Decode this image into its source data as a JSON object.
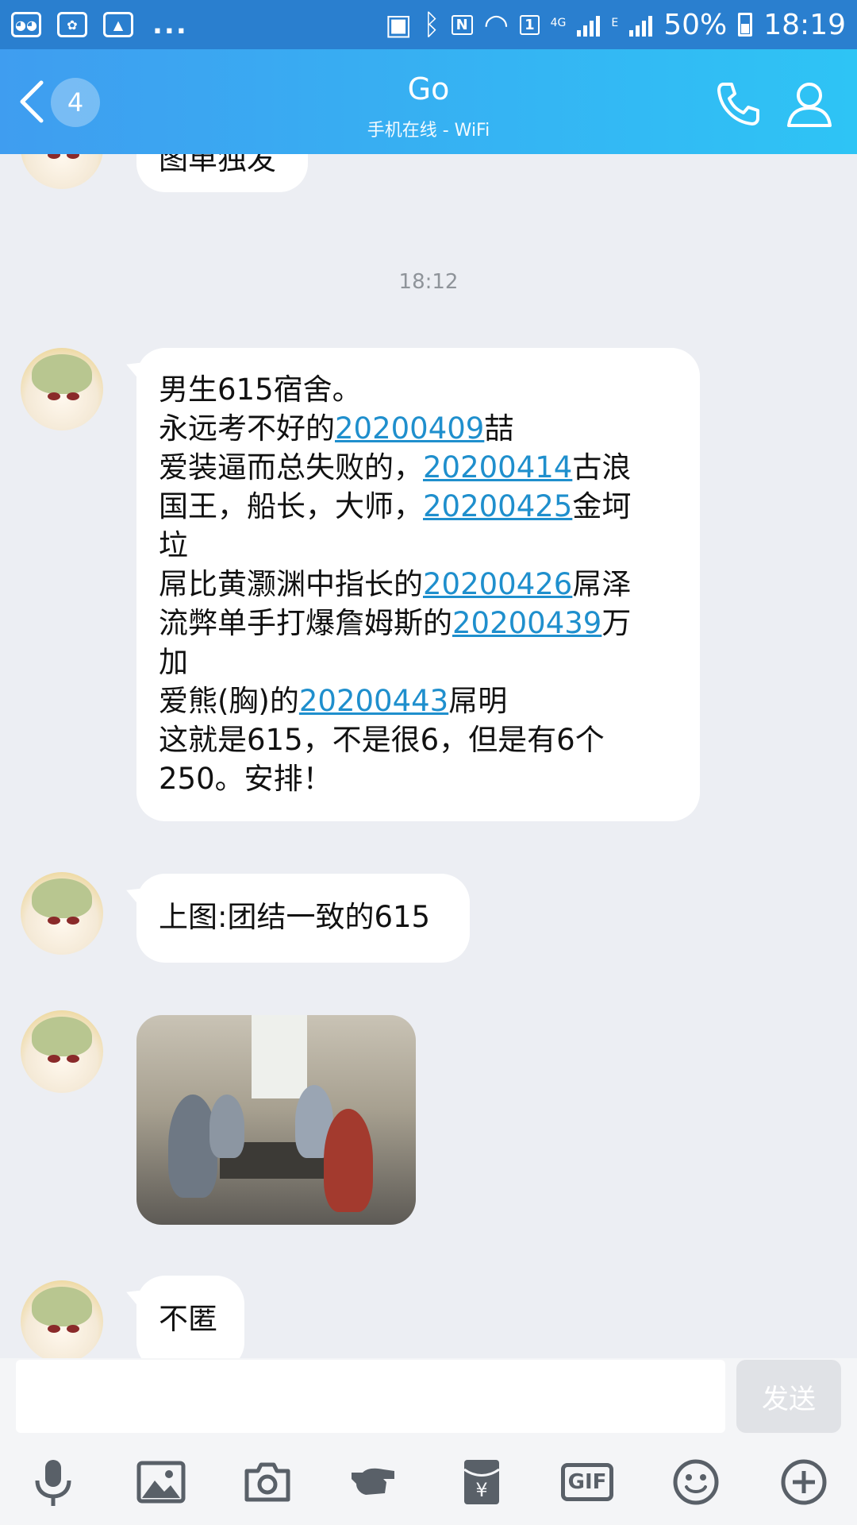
{
  "status_bar": {
    "left_icons": [
      "wechat-icon",
      "baidu-icon",
      "image-icon"
    ],
    "more": "...",
    "network": "4G",
    "network_e": "E",
    "sim": "1",
    "battery": "50%",
    "time": "18:19"
  },
  "header": {
    "back_badge": "4",
    "title": "Go",
    "subtitle": "手机在线 - WiFi",
    "icons": [
      "phone-icon",
      "person-icon"
    ]
  },
  "chat": {
    "partial_message": "图单独发",
    "timestamp": "18:12",
    "message1": {
      "lines": [
        [
          {
            "t": "男生615宿舍。"
          }
        ],
        [
          {
            "t": "永远考不好的"
          },
          {
            "t": "20200409",
            "link": true
          },
          {
            "t": "喆"
          }
        ],
        [
          {
            "t": "爱装逼而总失败的，"
          },
          {
            "t": "20200414",
            "link": true
          },
          {
            "t": "古浪"
          }
        ],
        [
          {
            "t": "国王，船长，大师，"
          },
          {
            "t": "20200425",
            "link": true
          },
          {
            "t": "金坷"
          }
        ],
        [
          {
            "t": "垃"
          }
        ],
        [
          {
            "t": "屌比黄灏渊中指长的"
          },
          {
            "t": "20200426",
            "link": true
          },
          {
            "t": "屌泽"
          }
        ],
        [
          {
            "t": "流弊单手打爆詹姆斯的"
          },
          {
            "t": "20200439",
            "link": true
          },
          {
            "t": "万"
          }
        ],
        [
          {
            "t": "加"
          }
        ],
        [
          {
            "t": "爱熊(胸)的"
          },
          {
            "t": "20200443",
            "link": true
          },
          {
            "t": "屌明"
          }
        ],
        [
          {
            "t": "这就是615，不是很6，但是有6个"
          }
        ],
        [
          {
            "t": "250。安排！"
          }
        ]
      ]
    },
    "message2": "上图:团结一致的615",
    "message4": "不匿"
  },
  "input": {
    "placeholder": "",
    "send_label": "发送"
  },
  "toolbar": {
    "items": [
      "microphone-icon",
      "image-icon",
      "camera-icon",
      "poke-icon",
      "red-envelope-icon",
      "gif-icon",
      "emoji-icon",
      "plus-icon"
    ],
    "gif_label": "GIF"
  },
  "colors": {
    "header_start": "#3f9df0",
    "header_end": "#2ec4f5",
    "link": "#1f8fcd",
    "background": "#eceef3"
  }
}
